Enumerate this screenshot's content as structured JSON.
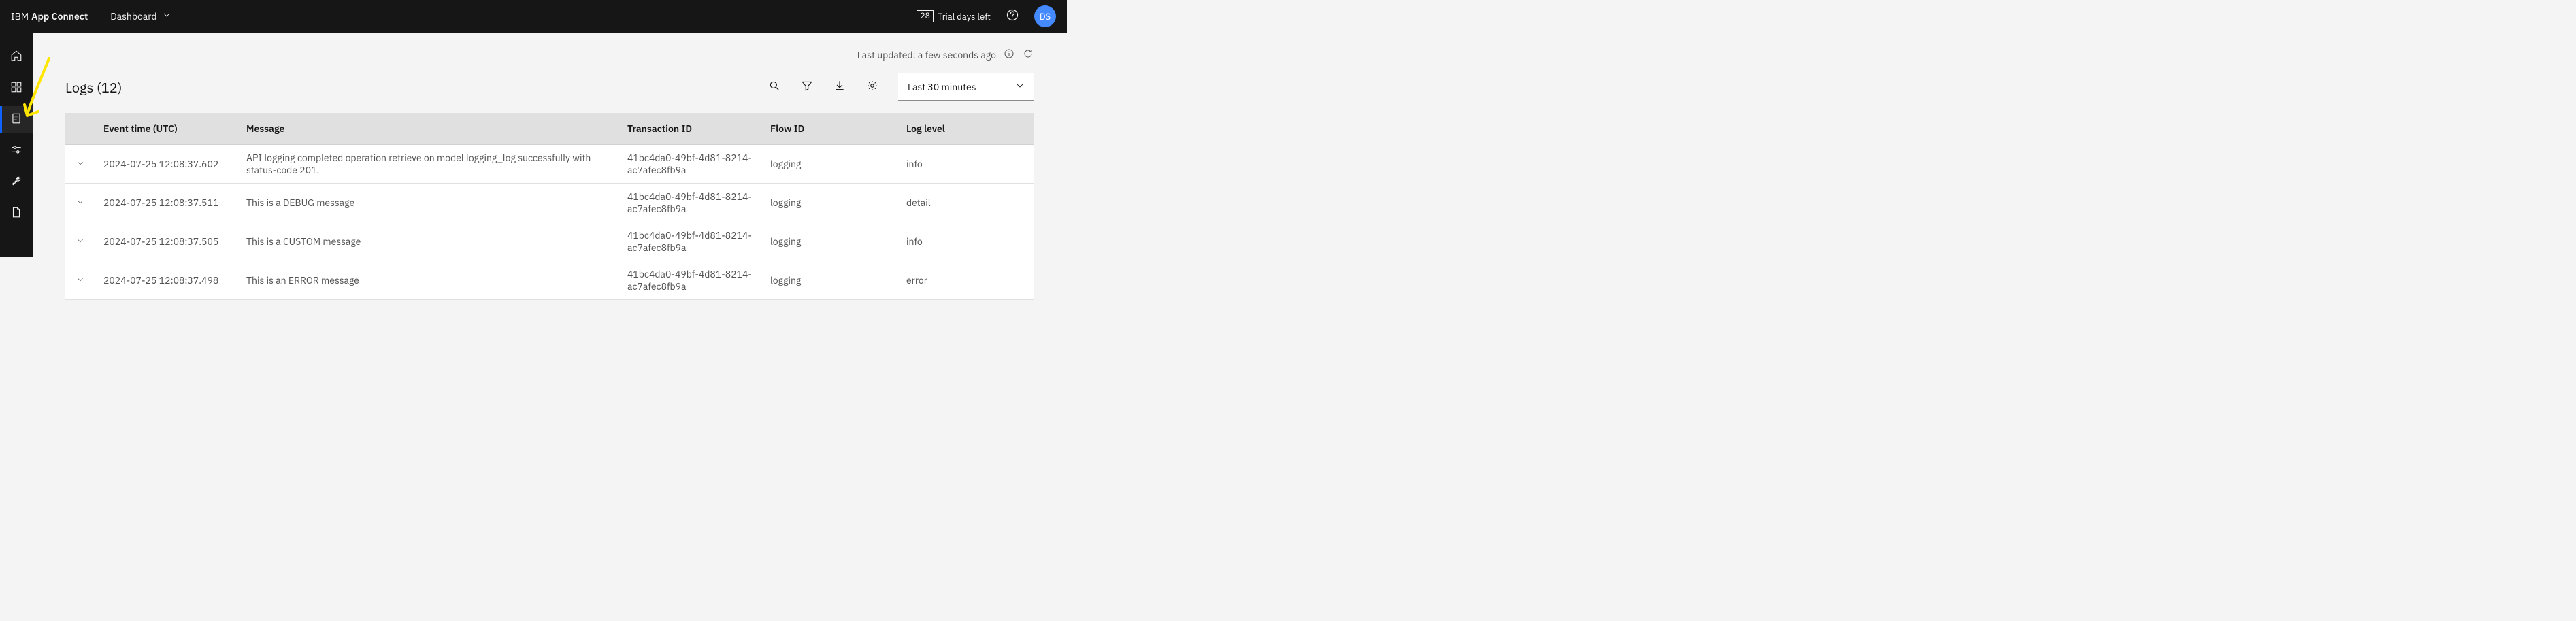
{
  "header": {
    "brand_prefix": "IBM",
    "brand_product": "App Connect",
    "nav_label": "Dashboard",
    "trial_days": "28",
    "trial_label": "Trial days left",
    "avatar_initials": "DS"
  },
  "side_nav": {
    "items": [
      {
        "name": "home-icon"
      },
      {
        "name": "catalog-icon"
      },
      {
        "name": "logs-icon",
        "active": true
      },
      {
        "name": "settings-slider-icon"
      },
      {
        "name": "tools-icon"
      },
      {
        "name": "document-icon"
      }
    ]
  },
  "main": {
    "last_updated_label": "Last updated: a few seconds ago",
    "title": "Logs (12)",
    "time_range_selected": "Last 30 minutes"
  },
  "table": {
    "columns": {
      "event_time": "Event time (UTC)",
      "message": "Message",
      "transaction_id": "Transaction ID",
      "flow_id": "Flow ID",
      "log_level": "Log level"
    },
    "rows": [
      {
        "time": "2024-07-25 12:08:37.602",
        "message": "API logging completed operation retrieve on model logging_log successfully with status-code 201.",
        "txn": "41bc4da0-49bf-4d81-8214-ac7afec8fb9a",
        "flow": "logging",
        "level": "info"
      },
      {
        "time": "2024-07-25 12:08:37.511",
        "message": "This is a DEBUG message",
        "txn": "41bc4da0-49bf-4d81-8214-ac7afec8fb9a",
        "flow": "logging",
        "level": "detail"
      },
      {
        "time": "2024-07-25 12:08:37.505",
        "message": "This is a CUSTOM message",
        "txn": "41bc4da0-49bf-4d81-8214-ac7afec8fb9a",
        "flow": "logging",
        "level": "info"
      },
      {
        "time": "2024-07-25 12:08:37.498",
        "message": "This is an ERROR message",
        "txn": "41bc4da0-49bf-4d81-8214-ac7afec8fb9a",
        "flow": "logging",
        "level": "error"
      }
    ]
  }
}
